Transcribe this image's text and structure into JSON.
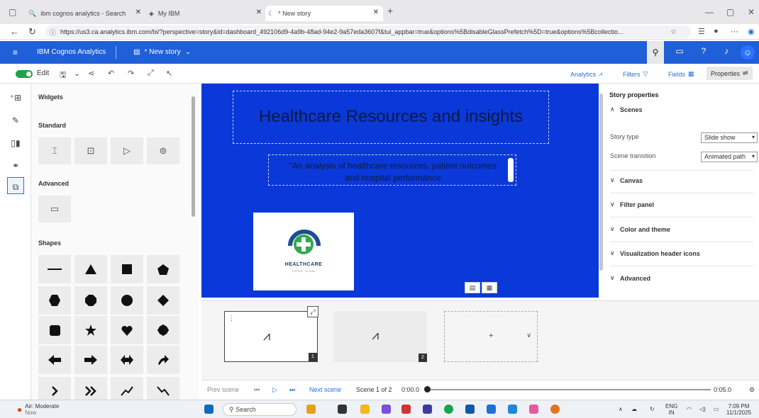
{
  "browser": {
    "tabs": [
      {
        "label": "ibm cognos analytics - Search"
      },
      {
        "label": "My IBM"
      },
      {
        "label": "* New story"
      }
    ],
    "url": "https://us3.ca.analytics.ibm.com/bi/?perspective=story&id=dashboard_492106d9-4a9b-48ad-94e2-9a57eda3607f&tui_appbar=true&options%5BdisableGlassPrefetch%5D=true&options%5Bcollectio..."
  },
  "app": {
    "brand": "IBM Cognos Analytics",
    "story_title": "* New story"
  },
  "toolbar": {
    "edit_label": "Edit",
    "analytics": "Analytics",
    "filters": "Filters",
    "fields": "Fields",
    "properties": "Properties"
  },
  "widgets": {
    "heading": "Widgets",
    "standard": "Standard",
    "advanced": "Advanced",
    "shapes": "Shapes"
  },
  "canvas": {
    "title": "Healthcare Resources and insights",
    "subtitle": "\"An analysis of healthcare resources, patient outcomes and hospital performance",
    "logo_text": "HEALTHCARE",
    "logo_sub": "LOGO ICON",
    "background": "#0a38d9"
  },
  "properties": {
    "title": "Story properties",
    "scenes": "Scenes",
    "story_type_label": "Story type",
    "story_type_value": "Slide show",
    "scene_transition_label": "Scene transition",
    "scene_transition_value": "Animated path",
    "sections": [
      "Canvas",
      "Filter panel",
      "Color and theme",
      "Visualization header icons",
      "Advanced"
    ]
  },
  "scenes": [
    {
      "number": "1"
    },
    {
      "number": "2"
    }
  ],
  "add_scene": "+",
  "playback": {
    "prev": "Prev scene",
    "next": "Next scene",
    "count": "Scene 1 of 2",
    "start_time": "0:00.0",
    "end_time": "0:05.0"
  },
  "taskbar": {
    "weather_title": "Air: Moderate",
    "weather_sub": "Now",
    "search": "Search",
    "lang": "ENG",
    "lang_sub": "IN",
    "time": "7:09 PM",
    "date": "11/1/2025"
  },
  "colors": {
    "header": "#1f5fd8",
    "accent": "#2c6de0",
    "toggle": "#24a148"
  }
}
